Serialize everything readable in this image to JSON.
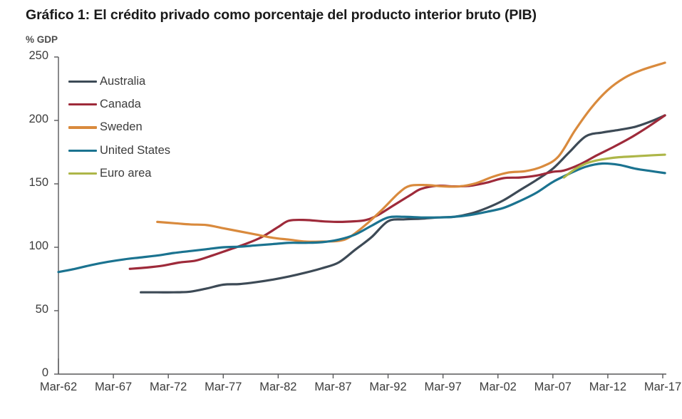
{
  "chart_data": {
    "type": "line",
    "title": "Gráfico 1: El crédito privado como porcentaje del producto interior bruto (PIB)",
    "ylabel": "% GDP",
    "xlabel": "",
    "ylim": [
      0,
      250
    ],
    "yticks": [
      0,
      50,
      100,
      150,
      200,
      250
    ],
    "ytick_labels": [
      "0",
      "50",
      "100",
      "150",
      "200",
      "250"
    ],
    "xticks": [
      "Mar-62",
      "Mar-67",
      "Mar-72",
      "Mar-77",
      "Mar-82",
      "Mar-87",
      "Mar-92",
      "Mar-97",
      "Mar-02",
      "Mar-07",
      "Mar-12",
      "Mar-17"
    ],
    "grid": false,
    "legend_position": "top-left",
    "x_start_year": 1962,
    "x_end_year": 2017,
    "series": [
      {
        "name": "Australia",
        "color": "#3d4a56",
        "points": [
          [
            1969.5,
            64.5
          ],
          [
            1971.0,
            64.5
          ],
          [
            1972.5,
            64.5
          ],
          [
            1974.0,
            65.0
          ],
          [
            1975.5,
            67.5
          ],
          [
            1977.0,
            70.5
          ],
          [
            1978.5,
            71.0
          ],
          [
            1980.0,
            72.5
          ],
          [
            1981.5,
            74.5
          ],
          [
            1983.0,
            77.0
          ],
          [
            1984.5,
            80.0
          ],
          [
            1986.0,
            83.5
          ],
          [
            1987.5,
            88.0
          ],
          [
            1989.0,
            98.0
          ],
          [
            1990.5,
            108.0
          ],
          [
            1992.0,
            120.5
          ],
          [
            1993.5,
            122.0
          ],
          [
            1995.0,
            122.5
          ],
          [
            1996.5,
            123.5
          ],
          [
            1998.0,
            124.0
          ],
          [
            1999.5,
            126.5
          ],
          [
            2001.0,
            131.0
          ],
          [
            2002.5,
            137.0
          ],
          [
            2004.0,
            145.0
          ],
          [
            2005.5,
            153.0
          ],
          [
            2007.0,
            162.0
          ],
          [
            2008.5,
            175.0
          ],
          [
            2010.0,
            187.5
          ],
          [
            2011.5,
            190.5
          ],
          [
            2013.0,
            192.5
          ],
          [
            2014.5,
            195.0
          ],
          [
            2016.0,
            199.5
          ],
          [
            2017.2,
            204.0
          ]
        ]
      },
      {
        "name": "Canada",
        "color": "#9e2a3a",
        "points": [
          [
            1968.5,
            83.0
          ],
          [
            1970.0,
            84.0
          ],
          [
            1971.5,
            85.5
          ],
          [
            1973.0,
            88.0
          ],
          [
            1974.5,
            89.5
          ],
          [
            1976.0,
            93.5
          ],
          [
            1977.5,
            98.0
          ],
          [
            1979.0,
            102.5
          ],
          [
            1980.5,
            108.0
          ],
          [
            1982.0,
            116.0
          ],
          [
            1983.0,
            121.0
          ],
          [
            1984.5,
            121.5
          ],
          [
            1986.0,
            120.5
          ],
          [
            1987.5,
            120.0
          ],
          [
            1989.0,
            120.5
          ],
          [
            1990.0,
            121.5
          ],
          [
            1991.0,
            125.0
          ],
          [
            1992.5,
            133.0
          ],
          [
            1994.0,
            141.0
          ],
          [
            1995.0,
            146.0
          ],
          [
            1996.5,
            148.5
          ],
          [
            1998.0,
            148.0
          ],
          [
            1999.5,
            148.5
          ],
          [
            2001.0,
            151.0
          ],
          [
            2002.5,
            154.5
          ],
          [
            2004.0,
            155.0
          ],
          [
            2005.5,
            156.5
          ],
          [
            2007.0,
            159.5
          ],
          [
            2008.0,
            160.5
          ],
          [
            2009.5,
            165.5
          ],
          [
            2011.0,
            172.5
          ],
          [
            2012.5,
            179.0
          ],
          [
            2014.0,
            186.0
          ],
          [
            2015.5,
            194.0
          ],
          [
            2017.2,
            204.0
          ]
        ]
      },
      {
        "name": "Sweden",
        "color": "#d98a3d",
        "points": [
          [
            1971.0,
            120.0
          ],
          [
            1972.5,
            119.0
          ],
          [
            1974.0,
            118.0
          ],
          [
            1975.5,
            117.5
          ],
          [
            1977.0,
            115.0
          ],
          [
            1978.5,
            112.5
          ],
          [
            1980.0,
            110.0
          ],
          [
            1981.5,
            107.5
          ],
          [
            1983.0,
            106.0
          ],
          [
            1984.5,
            104.5
          ],
          [
            1986.0,
            104.5
          ],
          [
            1987.5,
            105.0
          ],
          [
            1988.5,
            108.0
          ],
          [
            1990.0,
            118.0
          ],
          [
            1991.5,
            130.0
          ],
          [
            1993.0,
            143.0
          ],
          [
            1994.0,
            148.5
          ],
          [
            1995.5,
            149.0
          ],
          [
            1997.0,
            148.0
          ],
          [
            1998.5,
            148.0
          ],
          [
            2000.0,
            150.5
          ],
          [
            2001.5,
            155.5
          ],
          [
            2003.0,
            159.0
          ],
          [
            2004.5,
            160.0
          ],
          [
            2006.0,
            163.5
          ],
          [
            2007.5,
            171.5
          ],
          [
            2009.0,
            192.0
          ],
          [
            2010.5,
            210.0
          ],
          [
            2012.0,
            224.0
          ],
          [
            2013.5,
            233.5
          ],
          [
            2015.0,
            239.5
          ],
          [
            2017.2,
            245.5
          ]
        ]
      },
      {
        "name": "United States",
        "color": "#1b7390",
        "points": [
          [
            1962.0,
            80.5
          ],
          [
            1963.5,
            83.0
          ],
          [
            1965.0,
            86.0
          ],
          [
            1966.5,
            88.5
          ],
          [
            1968.0,
            90.5
          ],
          [
            1969.5,
            92.0
          ],
          [
            1971.0,
            93.5
          ],
          [
            1972.5,
            95.5
          ],
          [
            1974.0,
            97.0
          ],
          [
            1975.5,
            98.5
          ],
          [
            1977.0,
            100.0
          ],
          [
            1978.5,
            100.5
          ],
          [
            1980.0,
            101.5
          ],
          [
            1981.5,
            102.5
          ],
          [
            1983.0,
            103.5
          ],
          [
            1984.5,
            103.5
          ],
          [
            1986.0,
            104.0
          ],
          [
            1987.5,
            106.0
          ],
          [
            1989.0,
            110.0
          ],
          [
            1990.5,
            117.0
          ],
          [
            1992.0,
            123.5
          ],
          [
            1993.5,
            124.0
          ],
          [
            1995.0,
            123.5
          ],
          [
            1996.5,
            123.5
          ],
          [
            1998.0,
            124.0
          ],
          [
            1999.5,
            125.5
          ],
          [
            2001.0,
            128.0
          ],
          [
            2002.5,
            131.0
          ],
          [
            2004.0,
            136.5
          ],
          [
            2005.5,
            143.0
          ],
          [
            2007.0,
            151.5
          ],
          [
            2008.5,
            158.0
          ],
          [
            2010.0,
            163.5
          ],
          [
            2011.5,
            166.0
          ],
          [
            2013.0,
            165.0
          ],
          [
            2014.5,
            162.0
          ],
          [
            2016.0,
            160.0
          ],
          [
            2017.2,
            158.5
          ]
        ]
      },
      {
        "name": "Euro area",
        "color": "#adb648",
        "points": [
          [
            2008.0,
            155.0
          ],
          [
            2009.0,
            161.5
          ],
          [
            2010.0,
            166.0
          ],
          [
            2011.0,
            168.5
          ],
          [
            2012.0,
            170.0
          ],
          [
            2013.0,
            171.0
          ],
          [
            2014.0,
            171.5
          ],
          [
            2015.0,
            172.0
          ],
          [
            2016.0,
            172.5
          ],
          [
            2017.2,
            173.0
          ]
        ]
      }
    ]
  },
  "legend": {
    "items": [
      {
        "label": "Australia"
      },
      {
        "label": "Canada"
      },
      {
        "label": "Sweden"
      },
      {
        "label": "United States"
      },
      {
        "label": "Euro area"
      }
    ]
  }
}
